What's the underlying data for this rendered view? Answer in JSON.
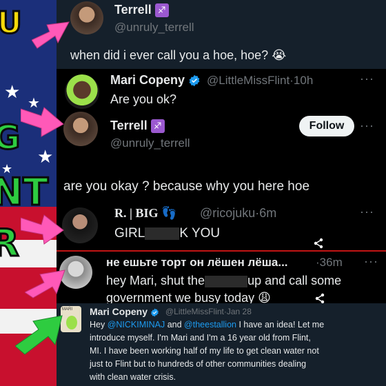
{
  "colors": {
    "background": "#000000",
    "dim_background": "#15202b",
    "text": "#e7e9ea",
    "muted": "#71767b",
    "link": "#1d9bf0",
    "verified": "#1d9bf0",
    "zodiac_badge": "#9b59d0",
    "arrow_pink": "#ff59b8",
    "divider_red": "#c21414",
    "flag_blue": "#1b2f7a",
    "flag_red": "#c8102e",
    "letter_green": "#2ecc40",
    "letter_yellow": "#f5d90a"
  },
  "overlay": {
    "letters": [
      "U",
      "G",
      "NT",
      "R"
    ]
  },
  "tweet_top": {
    "name": "Terrell",
    "zodiac_badge": "♐",
    "handle": "@unruly_terrell",
    "text": "when did i ever call you a hoe, hoe?",
    "emoji": "😭"
  },
  "tweet_mari": {
    "name": "Mari Copeny",
    "verified_icon": "verified-badge-icon",
    "handle": "@LittleMissFlint",
    "separator": "·",
    "time": "10h",
    "text": "Are you ok?",
    "more": "···"
  },
  "tweet_terrell": {
    "name": "Terrell",
    "zodiac_badge": "♐",
    "handle": "@unruly_terrell",
    "follow_label": "Follow",
    "more": "···",
    "text": "are you okay ? because why you here hoe"
  },
  "tweet_rbig": {
    "name": "R. | BIG",
    "footprints": "👣",
    "handle": "@ricojuku",
    "separator": "·",
    "time": "6m",
    "text_before": "GIRL",
    "text_after": "K YOU",
    "more": "···"
  },
  "tweet_ru": {
    "name": "не ешьте торт он лёшен лёша...",
    "separator": "·",
    "time": "36m",
    "more": "···",
    "line1_before": "hey Mari, shut the",
    "line1_after": "up and call some",
    "line2": "government we busy today",
    "emoji": "😩"
  },
  "tweet_old": {
    "name": "Mari Copeny",
    "handle": "@LittleMissFlint",
    "separator": "·",
    "time": "Jan 28",
    "avatar_label": "MARI",
    "line1_a": "Hey ",
    "mention1": "@NICKIMINAJ",
    "line1_b": " and ",
    "mention2": "@theestallion",
    "line1_c": " I have an idea! Let me",
    "line2": "introduce myself. I'm Mari and I'm a 16 year old from Flint,",
    "line3": "MI.  I have been working half of my life to get clean water not",
    "line4": "just to Flint but to hundreds of other communities dealing",
    "line5": "with clean water crisis."
  }
}
